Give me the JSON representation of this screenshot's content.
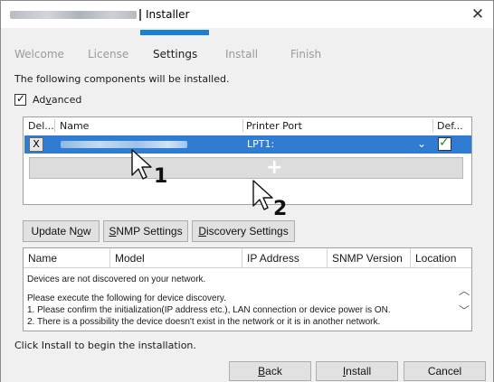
{
  "window": {
    "title": "Installer",
    "close_glyph": "✕"
  },
  "steps": [
    {
      "label": "Welcome",
      "active": false
    },
    {
      "label": "License",
      "active": false
    },
    {
      "label": "Settings",
      "active": true
    },
    {
      "label": "Install",
      "active": false
    },
    {
      "label": "Finish",
      "active": false
    }
  ],
  "heading": "The following components will be installed.",
  "advanced": {
    "label_pre": "Ad",
    "label_ul": "v",
    "label_post": "anced",
    "checked": true
  },
  "components_table": {
    "columns": [
      "Del...",
      "Name",
      "Printer Port",
      "Def..."
    ],
    "rows": [
      {
        "delete_label": "X",
        "printer_port": "LPT1:",
        "default_checked": true
      }
    ]
  },
  "annotations": {
    "cursor1": "1",
    "cursor2": "2"
  },
  "buttons": {
    "update_now": {
      "pre": "Update N",
      "ul": "o",
      "post": "w"
    },
    "snmp_settings": {
      "pre": "",
      "ul": "S",
      "post": "NMP Settings"
    },
    "discovery_settings": {
      "pre": "",
      "ul": "D",
      "post": "iscovery Settings"
    }
  },
  "devices_table": {
    "columns": [
      "Name",
      "Model",
      "IP Address",
      "SNMP Version",
      "Location"
    ],
    "messages": [
      "Devices are not discovered on your network.",
      "Please execute the following for device discovery.",
      "1. Please confirm the initialization(IP address etc.), LAN connection or device power is ON.",
      "2. There is a possibility the device doesn't exist in the network or it is in another network."
    ]
  },
  "footer_text": "Click Install to begin the installation.",
  "footer_buttons": {
    "back": {
      "pre": "",
      "ul": "B",
      "post": "ack"
    },
    "install": {
      "pre": "",
      "ul": "I",
      "post": "nstall"
    },
    "cancel": {
      "label": "Cancel"
    }
  },
  "colors": {
    "accent": "#1a7fd6",
    "selection": "#2f7cd2",
    "default_check": "#1f8a2a"
  }
}
